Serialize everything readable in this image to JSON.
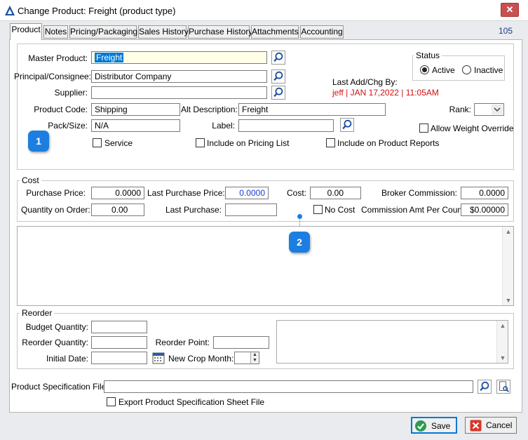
{
  "window": {
    "title": "Change Product: Freight (product type)",
    "close": "✕"
  },
  "tabs": [
    "Product",
    "Notes",
    "Pricing/Packaging",
    "Sales History",
    "Purchase History",
    "Attachments",
    "Accounting"
  ],
  "record_number": "105",
  "product": {
    "master_product_label": "Master Product:",
    "master_product_value": "Freight",
    "principal_label": "Principal/Consignee:",
    "principal_value": "Distributor Company",
    "supplier_label": "Supplier:",
    "supplier_value": "",
    "product_code_label": "Product Code:",
    "product_code_value": "Shipping",
    "alt_description_label": "Alt Description:",
    "alt_description_value": "Freight",
    "pack_size_label": "Pack/Size:",
    "pack_size_value": "N/A",
    "label_label": "Label:",
    "label_value": "",
    "rank_label": "Rank:",
    "service_label": "Service",
    "include_pricing_label": "Include on Pricing List",
    "include_reports_label": "Include on Product Reports",
    "allow_weight_label": "Allow Weight Override",
    "last_add_label": "Last Add/Chg By:",
    "last_add_value": "jeff | JAN 17,2022 | 11:05AM"
  },
  "status": {
    "legend": "Status",
    "active_label": "Active",
    "inactive_label": "Inactive",
    "selected": "Active"
  },
  "cost": {
    "legend": "Cost",
    "purchase_price_label": "Purchase Price:",
    "purchase_price_value": "0.0000",
    "last_purchase_price_label": "Last Purchase Price:",
    "last_purchase_price_value": "0.0000",
    "cost_label": "Cost:",
    "cost_value": "0.00",
    "broker_commission_label": "Broker Commission:",
    "broker_commission_value": "0.0000",
    "quantity_on_order_label": "Quantity on Order:",
    "quantity_on_order_value": "0.00",
    "last_purchase_label": "Last Purchase:",
    "last_purchase_value": "",
    "no_cost_label": "No Cost",
    "commission_amt_label": "Commission Amt Per Count:",
    "commission_amt_value": "$0.00000"
  },
  "reorder": {
    "legend": "Reorder",
    "budget_quantity_label": "Budget Quantity:",
    "budget_quantity_value": "",
    "reorder_quantity_label": "Reorder Quantity:",
    "reorder_quantity_value": "",
    "reorder_point_label": "Reorder Point:",
    "reorder_point_value": "",
    "initial_date_label": "Initial Date:",
    "initial_date_value": "",
    "new_crop_month_label": "New Crop Month:",
    "new_crop_month_value": ""
  },
  "spec": {
    "file_label": "Product Specification File:",
    "file_value": "",
    "export_label": "Export Product Specification Sheet File"
  },
  "badges": [
    "1",
    "2"
  ],
  "buttons": {
    "save": "Save",
    "cancel": "Cancel"
  },
  "colors": {
    "accent": "#0078d7",
    "red_text": "#d01010",
    "badge": "#1c7ee0",
    "blue_value": "#1a3ad0"
  }
}
